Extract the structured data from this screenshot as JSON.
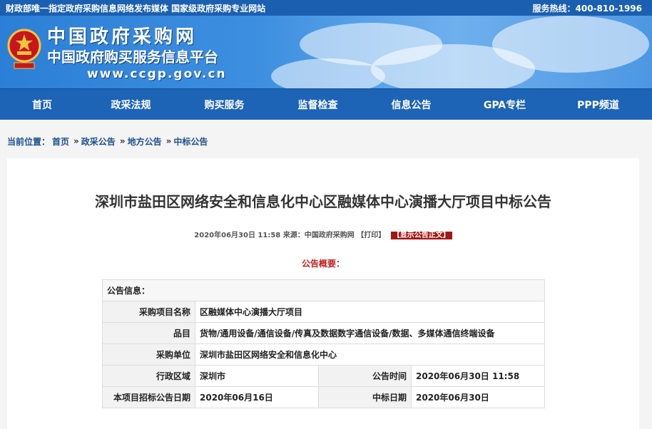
{
  "topbar": {
    "left": "财政部唯一指定政府采购信息网络发布媒体 国家级政府采购专业网站",
    "right": "服务热线：400-810-1996"
  },
  "brand": {
    "line1": "中国政府采购网",
    "line2": "中国政府购买服务信息平台",
    "url": "www.ccgp.gov.cn"
  },
  "nav": [
    "首页",
    "政采法规",
    "购买服务",
    "监督检查",
    "信息公告",
    "GPA专栏",
    "PPP频道"
  ],
  "breadcrumb": {
    "prefix": "当前位置：",
    "items": [
      "首页",
      "政采公告",
      "地方公告",
      "中标公告"
    ]
  },
  "article": {
    "title": "深圳市盐田区网络安全和信息化中心区融媒体中心演播大厅项目中标公告",
    "meta": "2020年06月30日 11:58 来源：中国政府采购网 【打印】",
    "show_full": "【显示公告正文】",
    "summary": "公告概要："
  },
  "table": {
    "header": "公告信息：",
    "project_name_label": "采购项目名称",
    "project_name": "区融媒体中心演播大厅项目",
    "category_label": "品目",
    "category": "货物/通用设备/通信设备/传真及数据数字通信设备/数据、多媒体通信终端设备",
    "buyer_label": "采购单位",
    "buyer": "深圳市盐田区网络安全和信息化中心",
    "region_label": "行政区域",
    "region": "深圳市",
    "pub_time_label": "公告时间",
    "pub_time": "2020年06月30日 11:58",
    "bid_date_label": "本项目招标公告日期",
    "bid_date": "2020年06月16日",
    "award_date_label": "中标日期",
    "award_date": "2020年06月30日"
  }
}
